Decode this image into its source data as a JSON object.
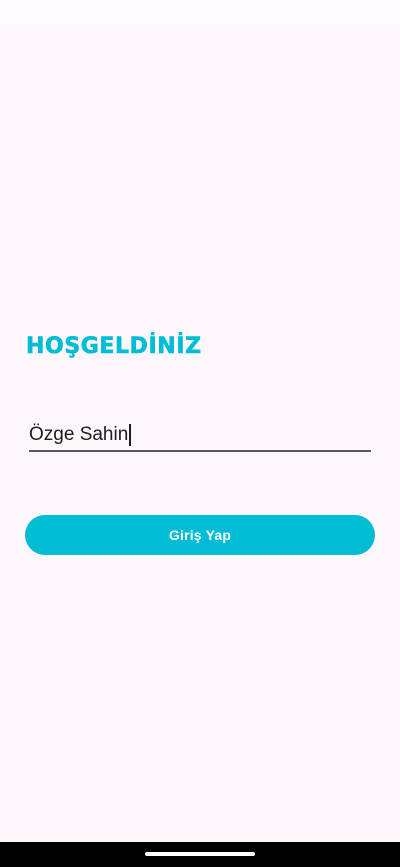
{
  "screen": {
    "title": "HOŞGELDİNİZ"
  },
  "form": {
    "name_value": "Özge Sahin",
    "submit_label": "Giriş Yap"
  },
  "colors": {
    "accent": "#00bcd4",
    "background": "#fdf7fb",
    "underline": "#5c5466"
  }
}
